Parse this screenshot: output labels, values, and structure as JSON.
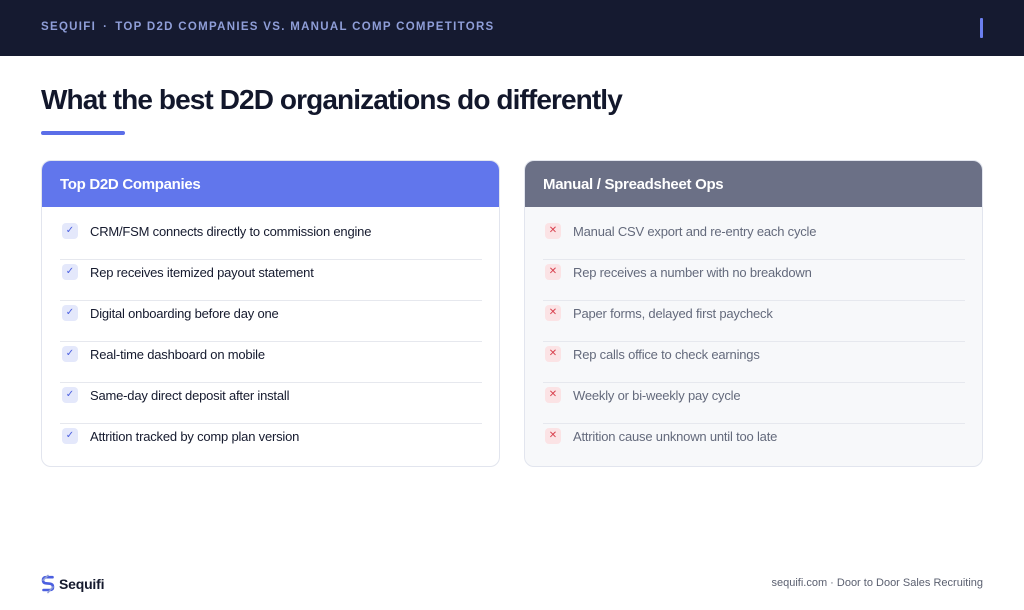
{
  "header": {
    "brand": "SEQUIFI",
    "separator": "·",
    "subtitle": "TOP D2D COMPANIES VS. MANUAL COMP COMPETITORS"
  },
  "title": "What the best D2D organizations do differently",
  "colors": {
    "accent": "#5b6ee8",
    "left_header": "#6176ec",
    "right_header": "#6b7086",
    "topbar": "#151a30",
    "check": "#4b5fe0",
    "cross": "#d8404e"
  },
  "left_card": {
    "title": "Top D2D Companies",
    "icon": "check-icon",
    "items": [
      "CRM/FSM connects directly to commission engine",
      "Rep receives itemized payout statement",
      "Digital onboarding before day one",
      "Real-time dashboard on mobile",
      "Same-day direct deposit after install",
      "Attrition tracked by comp plan version"
    ]
  },
  "right_card": {
    "title": "Manual / Spreadsheet Ops",
    "icon": "cross-icon",
    "items": [
      "Manual CSV export and re-entry each cycle",
      "Rep receives a number with no breakdown",
      "Paper forms, delayed first paycheck",
      "Rep calls office to check earnings",
      "Weekly or bi-weekly pay cycle",
      "Attrition cause unknown until too late"
    ]
  },
  "footer": {
    "logo_text": "Sequifi",
    "right_text": "sequifi.com · Door to Door Sales Recruiting"
  }
}
